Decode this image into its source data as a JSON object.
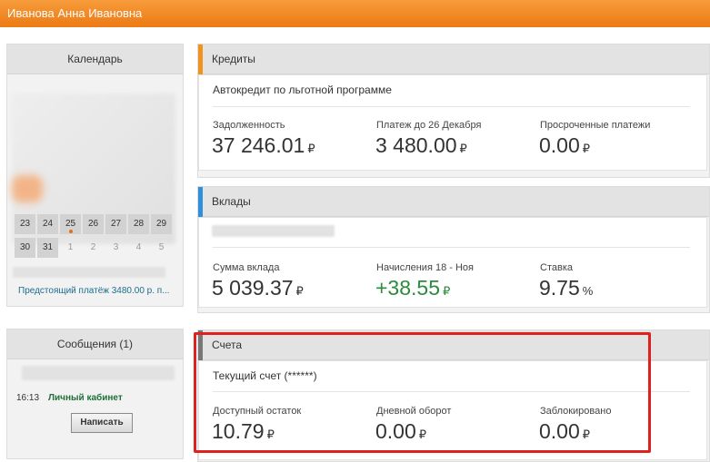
{
  "header": {
    "user_name": "Иванова Анна Ивановна"
  },
  "calendar": {
    "title": "Календарь",
    "rows": [
      [
        "23",
        "24",
        "25",
        "26",
        "27",
        "28",
        "29"
      ],
      [
        "30",
        "31",
        "1",
        "2",
        "3",
        "4",
        "5"
      ]
    ],
    "upcoming_payment": "Предстоящий платёж 3480.00 р. п..."
  },
  "messages": {
    "title": "Сообщения (1)",
    "item_time": "16:13",
    "item_link": "Личный кабинет",
    "write_button": "Написать"
  },
  "credits": {
    "title": "Кредиты",
    "product": "Автокредит по льготной программе",
    "debt_label": "Задолженность",
    "debt_value": "37 246.01",
    "payment_label": "Платеж до 26 Декабря",
    "payment_value": "3 480.00",
    "overdue_label": "Просроченные платежи",
    "overdue_value": "0.00"
  },
  "deposits": {
    "title": "Вклады",
    "sum_label": "Сумма вклада",
    "sum_value": "5 039.37",
    "accrual_label": "Начисления 18 - Ноя",
    "accrual_value": "+38.55",
    "rate_label": "Ставка",
    "rate_value": "9.75",
    "rate_unit": "%"
  },
  "accounts": {
    "title": "Счета",
    "account_name": "Текущий счет (******)",
    "available_label": "Доступный остаток",
    "available_value": "10.79",
    "turnover_label": "Дневной оборот",
    "turnover_value": "0.00",
    "blocked_label": "Заблокировано",
    "blocked_value": "0.00"
  },
  "currency_symbol": "₽",
  "colors": {
    "header_orange": "#ef8420",
    "credits_accent": "#f0921e",
    "deposits_accent": "#2f8fd8",
    "accounts_accent": "#777777",
    "highlight_red": "#e0201c",
    "positive_green": "#2e8a3e"
  }
}
